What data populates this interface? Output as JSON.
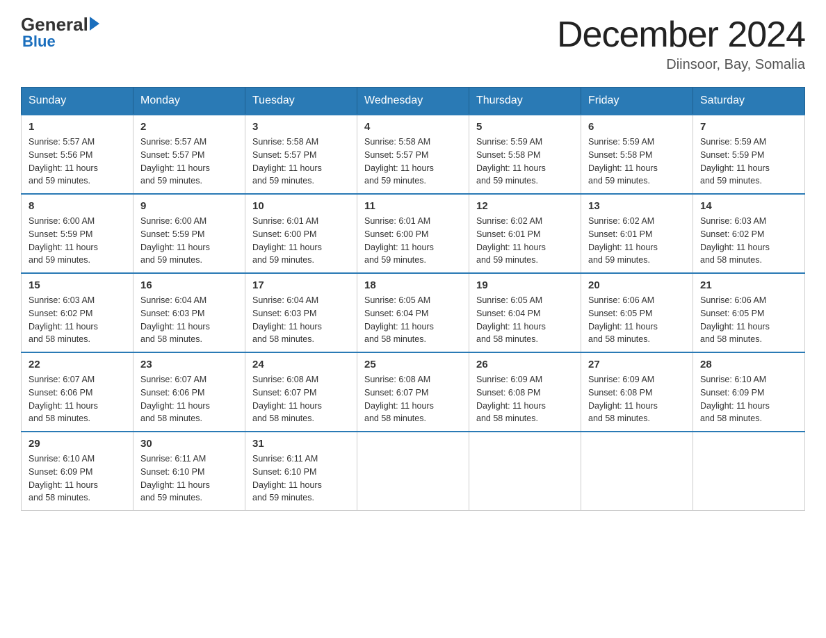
{
  "header": {
    "logo": {
      "general": "General",
      "blue": "Blue",
      "triangle": true
    },
    "title": "December 2024",
    "location": "Diinsoor, Bay, Somalia"
  },
  "days_of_week": [
    "Sunday",
    "Monday",
    "Tuesday",
    "Wednesday",
    "Thursday",
    "Friday",
    "Saturday"
  ],
  "weeks": [
    {
      "days": [
        {
          "num": "1",
          "sunrise": "5:57 AM",
          "sunset": "5:56 PM",
          "daylight": "11 hours and 59 minutes."
        },
        {
          "num": "2",
          "sunrise": "5:57 AM",
          "sunset": "5:57 PM",
          "daylight": "11 hours and 59 minutes."
        },
        {
          "num": "3",
          "sunrise": "5:58 AM",
          "sunset": "5:57 PM",
          "daylight": "11 hours and 59 minutes."
        },
        {
          "num": "4",
          "sunrise": "5:58 AM",
          "sunset": "5:57 PM",
          "daylight": "11 hours and 59 minutes."
        },
        {
          "num": "5",
          "sunrise": "5:59 AM",
          "sunset": "5:58 PM",
          "daylight": "11 hours and 59 minutes."
        },
        {
          "num": "6",
          "sunrise": "5:59 AM",
          "sunset": "5:58 PM",
          "daylight": "11 hours and 59 minutes."
        },
        {
          "num": "7",
          "sunrise": "5:59 AM",
          "sunset": "5:59 PM",
          "daylight": "11 hours and 59 minutes."
        }
      ]
    },
    {
      "days": [
        {
          "num": "8",
          "sunrise": "6:00 AM",
          "sunset": "5:59 PM",
          "daylight": "11 hours and 59 minutes."
        },
        {
          "num": "9",
          "sunrise": "6:00 AM",
          "sunset": "5:59 PM",
          "daylight": "11 hours and 59 minutes."
        },
        {
          "num": "10",
          "sunrise": "6:01 AM",
          "sunset": "6:00 PM",
          "daylight": "11 hours and 59 minutes."
        },
        {
          "num": "11",
          "sunrise": "6:01 AM",
          "sunset": "6:00 PM",
          "daylight": "11 hours and 59 minutes."
        },
        {
          "num": "12",
          "sunrise": "6:02 AM",
          "sunset": "6:01 PM",
          "daylight": "11 hours and 59 minutes."
        },
        {
          "num": "13",
          "sunrise": "6:02 AM",
          "sunset": "6:01 PM",
          "daylight": "11 hours and 59 minutes."
        },
        {
          "num": "14",
          "sunrise": "6:03 AM",
          "sunset": "6:02 PM",
          "daylight": "11 hours and 58 minutes."
        }
      ]
    },
    {
      "days": [
        {
          "num": "15",
          "sunrise": "6:03 AM",
          "sunset": "6:02 PM",
          "daylight": "11 hours and 58 minutes."
        },
        {
          "num": "16",
          "sunrise": "6:04 AM",
          "sunset": "6:03 PM",
          "daylight": "11 hours and 58 minutes."
        },
        {
          "num": "17",
          "sunrise": "6:04 AM",
          "sunset": "6:03 PM",
          "daylight": "11 hours and 58 minutes."
        },
        {
          "num": "18",
          "sunrise": "6:05 AM",
          "sunset": "6:04 PM",
          "daylight": "11 hours and 58 minutes."
        },
        {
          "num": "19",
          "sunrise": "6:05 AM",
          "sunset": "6:04 PM",
          "daylight": "11 hours and 58 minutes."
        },
        {
          "num": "20",
          "sunrise": "6:06 AM",
          "sunset": "6:05 PM",
          "daylight": "11 hours and 58 minutes."
        },
        {
          "num": "21",
          "sunrise": "6:06 AM",
          "sunset": "6:05 PM",
          "daylight": "11 hours and 58 minutes."
        }
      ]
    },
    {
      "days": [
        {
          "num": "22",
          "sunrise": "6:07 AM",
          "sunset": "6:06 PM",
          "daylight": "11 hours and 58 minutes."
        },
        {
          "num": "23",
          "sunrise": "6:07 AM",
          "sunset": "6:06 PM",
          "daylight": "11 hours and 58 minutes."
        },
        {
          "num": "24",
          "sunrise": "6:08 AM",
          "sunset": "6:07 PM",
          "daylight": "11 hours and 58 minutes."
        },
        {
          "num": "25",
          "sunrise": "6:08 AM",
          "sunset": "6:07 PM",
          "daylight": "11 hours and 58 minutes."
        },
        {
          "num": "26",
          "sunrise": "6:09 AM",
          "sunset": "6:08 PM",
          "daylight": "11 hours and 58 minutes."
        },
        {
          "num": "27",
          "sunrise": "6:09 AM",
          "sunset": "6:08 PM",
          "daylight": "11 hours and 58 minutes."
        },
        {
          "num": "28",
          "sunrise": "6:10 AM",
          "sunset": "6:09 PM",
          "daylight": "11 hours and 58 minutes."
        }
      ]
    },
    {
      "days": [
        {
          "num": "29",
          "sunrise": "6:10 AM",
          "sunset": "6:09 PM",
          "daylight": "11 hours and 58 minutes."
        },
        {
          "num": "30",
          "sunrise": "6:11 AM",
          "sunset": "6:10 PM",
          "daylight": "11 hours and 59 minutes."
        },
        {
          "num": "31",
          "sunrise": "6:11 AM",
          "sunset": "6:10 PM",
          "daylight": "11 hours and 59 minutes."
        },
        null,
        null,
        null,
        null
      ]
    }
  ],
  "labels": {
    "sunrise": "Sunrise:",
    "sunset": "Sunset:",
    "daylight": "Daylight:"
  }
}
